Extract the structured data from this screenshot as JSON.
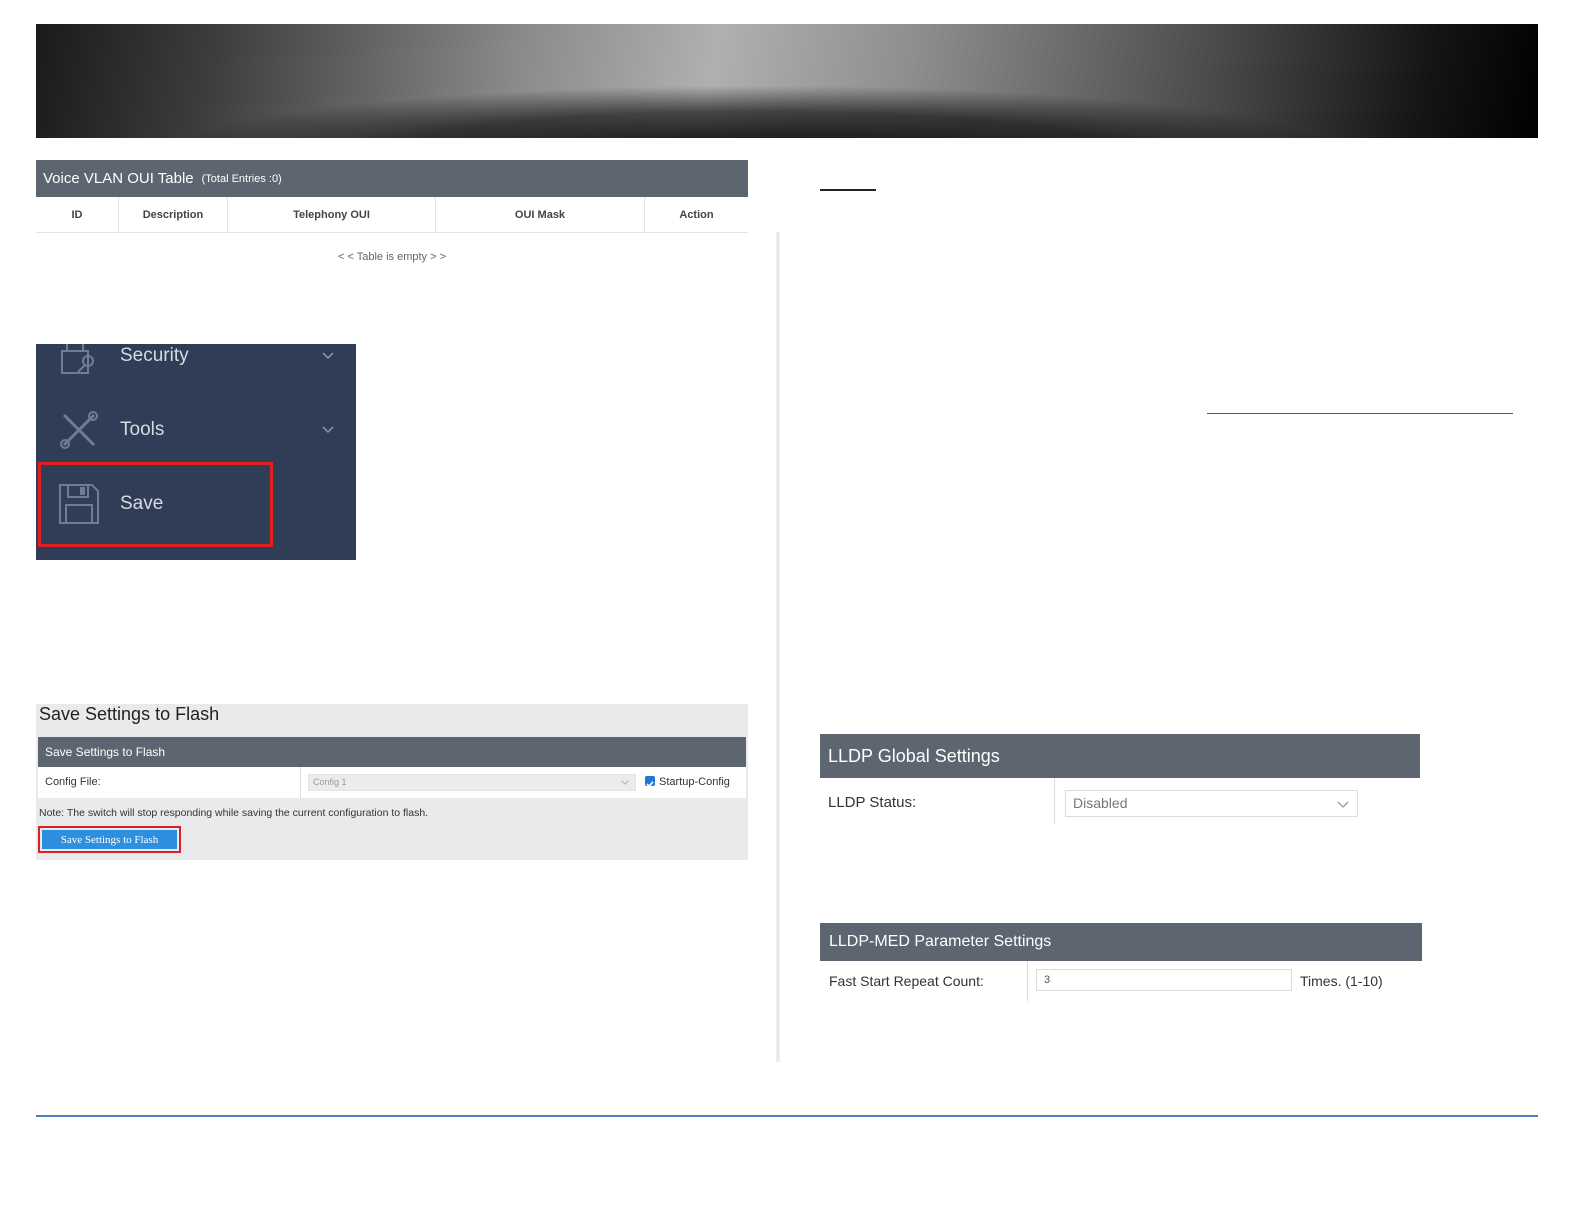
{
  "oui_table": {
    "title": "Voice VLAN OUI Table",
    "entries": "(Total Entries :0)",
    "columns": [
      "ID",
      "Description",
      "Telephony OUI",
      "OUI Mask",
      "Action"
    ],
    "empty_text": "< < Table is empty > >"
  },
  "nav": {
    "items": [
      {
        "label": "Security",
        "icon": "lock-icon",
        "has_chevron": true
      },
      {
        "label": "Tools",
        "icon": "tools-icon",
        "has_chevron": true
      },
      {
        "label": "Save",
        "icon": "floppy-disk-icon",
        "has_chevron": false,
        "highlighted": true
      }
    ]
  },
  "save_settings": {
    "page_title": "Save Settings to Flash",
    "section_title": "Save Settings to Flash",
    "config_file_label": "Config File:",
    "config_file_value": "Config 1",
    "startup_config_label": "Startup-Config",
    "startup_config_checked": true,
    "note": "Note: The switch will stop responding while saving the current configuration to flash.",
    "button_label": "Save Settings to Flash"
  },
  "lldp_global": {
    "title": "LLDP Global Settings",
    "status_label": "LLDP Status:",
    "status_value": "Disabled"
  },
  "lldp_med": {
    "title": "LLDP-MED Parameter Settings",
    "fast_start_label": "Fast Start Repeat Count:",
    "fast_start_value": "3",
    "fast_start_unit": "Times. (1-10)"
  },
  "colors": {
    "header_bar": "#5c6570",
    "nav_background": "#2f3d56",
    "highlight_border": "#e02020",
    "primary_button": "#2d8fe0",
    "footer_line": "#4a7fc1"
  }
}
